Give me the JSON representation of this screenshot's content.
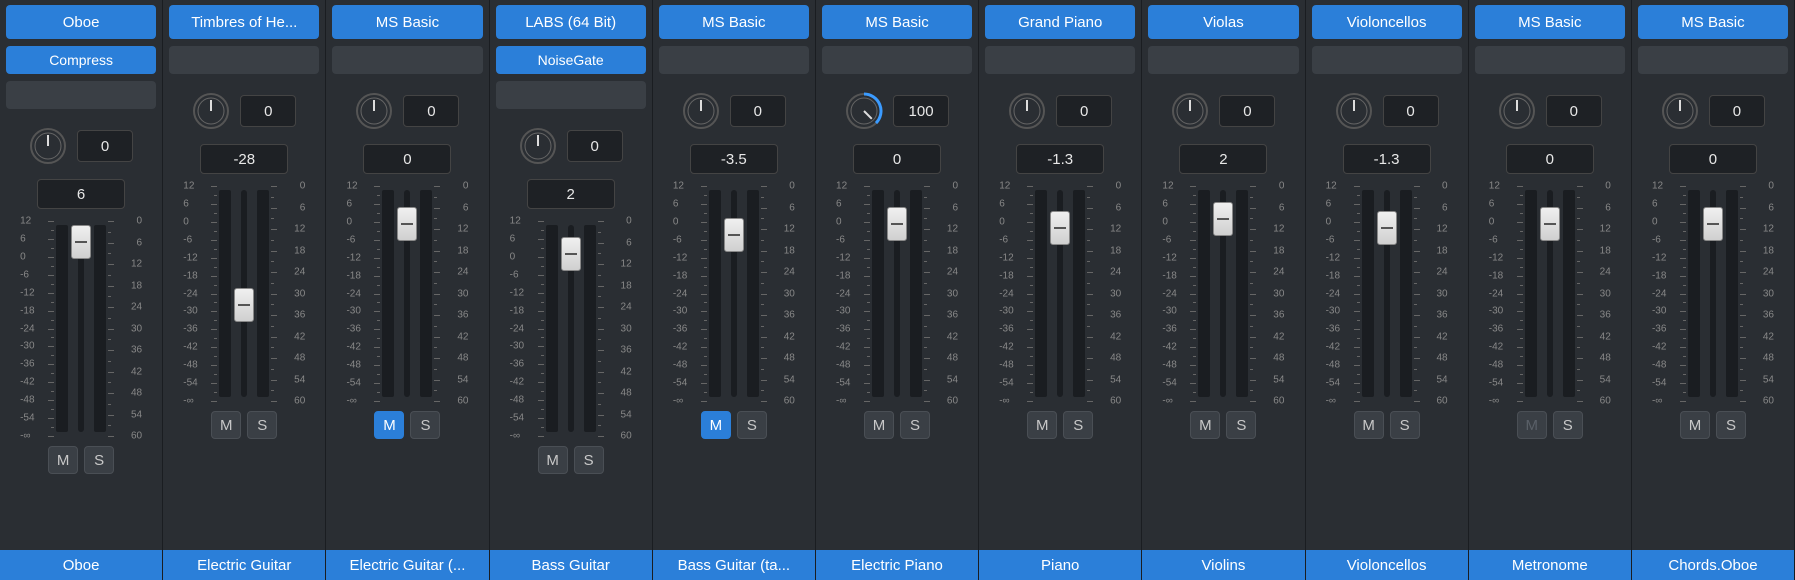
{
  "scale_left": [
    "12",
    "6",
    "0",
    "-6",
    "-12",
    "-18",
    "-24",
    "-30",
    "-36",
    "-42",
    "-48",
    "-54",
    "-∞"
  ],
  "scale_right": [
    "0",
    "6",
    "12",
    "18",
    "24",
    "30",
    "36",
    "42",
    "48",
    "54",
    "60"
  ],
  "channels": [
    {
      "instrument": "Oboe",
      "effect": "Compress",
      "effect_active": true,
      "extra_slot": true,
      "pan": 0,
      "pan_knob": 0,
      "vol": "6",
      "fader_db": 6,
      "mute": false,
      "mute_dim": false,
      "solo": false,
      "name": "Oboe"
    },
    {
      "instrument": "Timbres of He...",
      "effect": "",
      "effect_active": false,
      "extra_slot": false,
      "pan": 0,
      "pan_knob": 0,
      "vol": "-28",
      "fader_db": -28,
      "mute": false,
      "mute_dim": false,
      "solo": false,
      "name": "Electric Guitar"
    },
    {
      "instrument": "MS Basic",
      "effect": "",
      "effect_active": false,
      "extra_slot": false,
      "pan": 0,
      "pan_knob": 0,
      "vol": "0",
      "fader_db": 0,
      "mute": true,
      "mute_dim": false,
      "solo": false,
      "name": "Electric Guitar (..."
    },
    {
      "instrument": "LABS (64 Bit)",
      "effect": "NoiseGate",
      "effect_active": true,
      "extra_slot": true,
      "pan": 0,
      "pan_knob": 0,
      "vol": "2",
      "fader_db": 2,
      "mute": false,
      "mute_dim": false,
      "solo": false,
      "name": "Bass Guitar"
    },
    {
      "instrument": "MS Basic",
      "effect": "",
      "effect_active": false,
      "extra_slot": false,
      "pan": 0,
      "pan_knob": 0,
      "vol": "-3.5",
      "fader_db": -3.5,
      "mute": true,
      "mute_dim": false,
      "solo": false,
      "name": "Bass Guitar (ta..."
    },
    {
      "instrument": "MS Basic",
      "effect": "",
      "effect_active": false,
      "extra_slot": false,
      "pan": 100,
      "pan_knob": 100,
      "vol": "0",
      "fader_db": 0,
      "mute": false,
      "mute_dim": false,
      "solo": false,
      "name": "Electric Piano"
    },
    {
      "instrument": "Grand Piano",
      "effect": "",
      "effect_active": false,
      "extra_slot": false,
      "pan": 0,
      "pan_knob": 0,
      "vol": "-1.3",
      "fader_db": -1.3,
      "mute": false,
      "mute_dim": false,
      "solo": false,
      "name": "Piano"
    },
    {
      "instrument": "Violas",
      "effect": "",
      "effect_active": false,
      "extra_slot": false,
      "pan": 0,
      "pan_knob": 0,
      "vol": "2",
      "fader_db": 2,
      "mute": false,
      "mute_dim": false,
      "solo": false,
      "name": "Violins"
    },
    {
      "instrument": "Violoncellos",
      "effect": "",
      "effect_active": false,
      "extra_slot": false,
      "pan": 0,
      "pan_knob": 0,
      "vol": "-1.3",
      "fader_db": -1.3,
      "mute": false,
      "mute_dim": false,
      "solo": false,
      "name": "Violoncellos"
    },
    {
      "instrument": "MS Basic",
      "effect": "",
      "effect_active": false,
      "extra_slot": false,
      "pan": 0,
      "pan_knob": 0,
      "vol": "0",
      "fader_db": 0,
      "mute": false,
      "mute_dim": true,
      "solo": false,
      "name": "Metronome"
    },
    {
      "instrument": "MS Basic",
      "effect": "",
      "effect_active": false,
      "extra_slot": false,
      "pan": 0,
      "pan_knob": 0,
      "vol": "0",
      "fader_db": 0,
      "mute": false,
      "mute_dim": false,
      "solo": false,
      "name": "Chords.Oboe"
    }
  ]
}
